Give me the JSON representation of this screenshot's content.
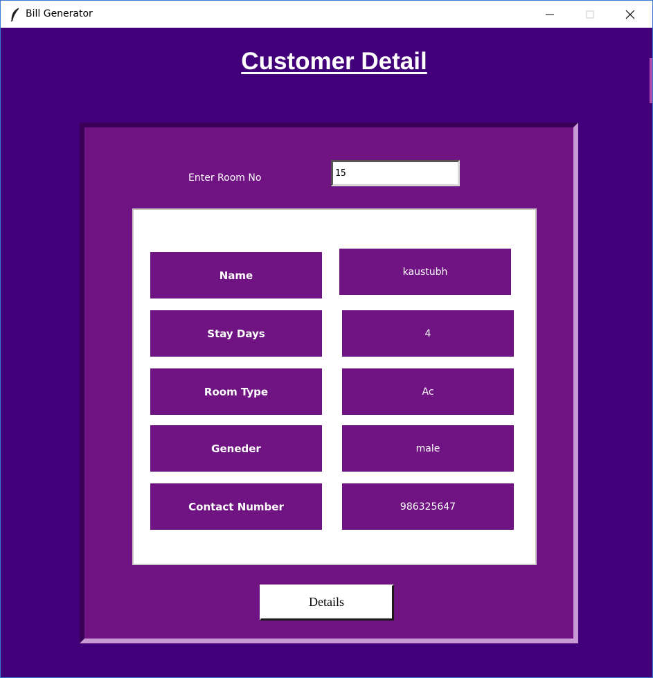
{
  "window": {
    "title": "Bill Generator",
    "icon": "feather-icon"
  },
  "page": {
    "heading": "Customer Detail"
  },
  "form": {
    "room_label": "Enter Room No",
    "room_value": "15"
  },
  "details": {
    "rows": [
      {
        "label": "Name",
        "value": "kaustubh"
      },
      {
        "label": "Stay Days",
        "value": "4"
      },
      {
        "label": "Room Type",
        "value": "Ac"
      },
      {
        "label": "Geneder",
        "value": "male"
      },
      {
        "label": "Contact Number",
        "value": "986325647"
      }
    ]
  },
  "actions": {
    "details_label": "Details"
  },
  "colors": {
    "background": "#41007a",
    "panel": "#6f1482",
    "inner": "#ffffff",
    "text": "#ffffff"
  }
}
